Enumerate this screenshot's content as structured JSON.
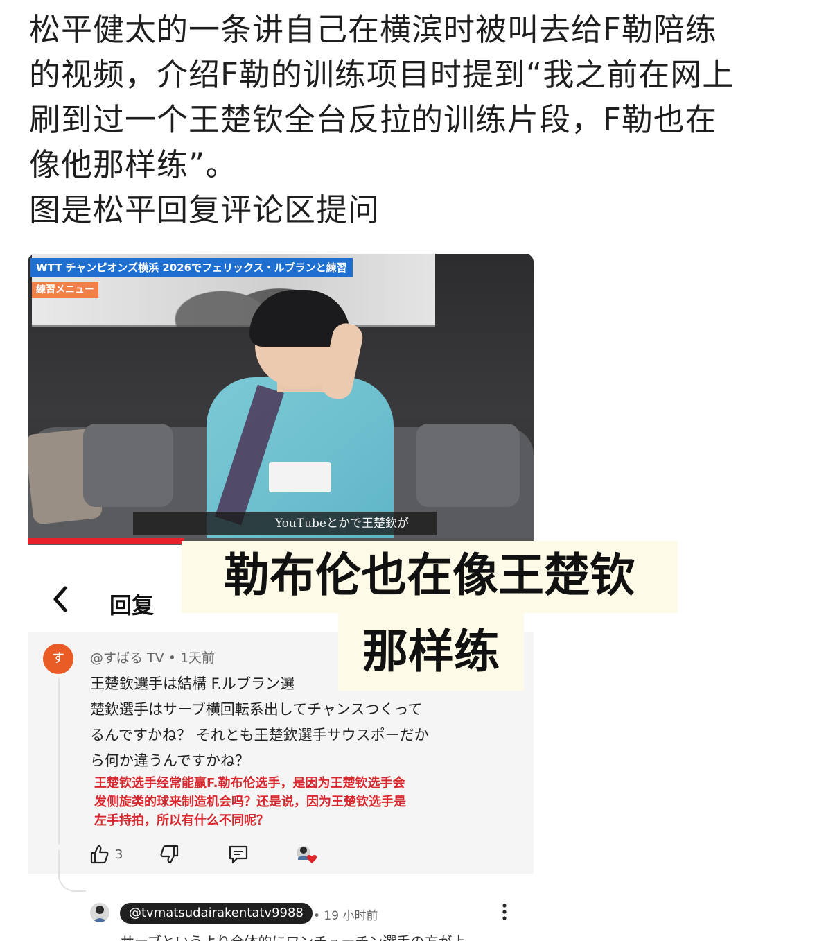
{
  "post": {
    "lines": [
      "松平健太的一条讲自己在横滨时被叫去给F勒陪练",
      "的视频，介绍F勒的训练项目时提到“我之前在网上",
      "刷到过一个王楚钦全台反拉的训练片段，F勒也在",
      "像他那样练”。",
      "图是松平回复评论区提问"
    ]
  },
  "video": {
    "title": "WTT チャンピオンズ横浜 2026でフェリックス・ルブランと練習",
    "menu_tag": "練習メニュー",
    "subtitle": "YouTubeとかで王楚欽が",
    "progress": 0.31,
    "accent_color": "#e8202a"
  },
  "reply_sheet": {
    "back_icon": "chevron-left-icon",
    "title": "回复"
  },
  "comment": {
    "avatar_text": "す",
    "author": "@すばる TV",
    "time": "1天前",
    "body_lines": [
      "王楚欽選手は結構 F.ルブラン選",
      "楚欽選手はサーブ横回転系出してチャンスつくって",
      "るんですかね？ それとも王楚欽選手サウスポーだか",
      "ら何か違うんですかね？"
    ],
    "translation_lines": [
      "王楚钦选手经常能赢F.勒布伦选手，是因为王楚钦选手会",
      "发侧旋类的球来制造机会吗？还是说，因为王楚钦选手是",
      "左手持拍，所以有什么不同呢？"
    ],
    "like_count": "3",
    "translation_color": "#d8282f"
  },
  "reply": {
    "handle": "@tvmatsudairakentatv9988",
    "time": "• 19 小时前",
    "text": "サーブというより全体的にワンチューチン選手の方が上"
  },
  "caption": {
    "line1": "勒布伦也在像王楚钦",
    "line2": "那样练"
  }
}
